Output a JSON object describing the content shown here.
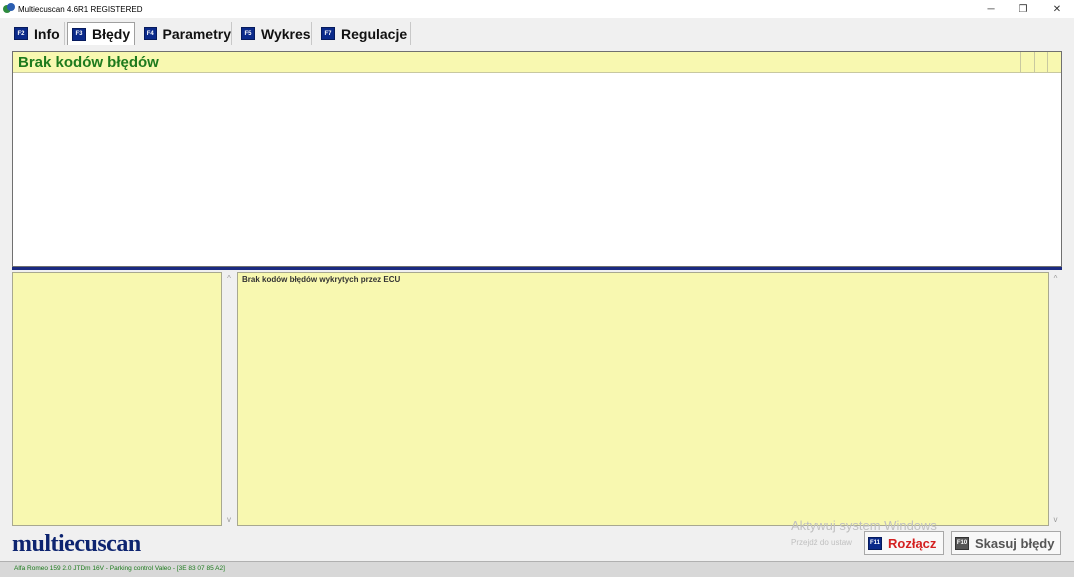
{
  "window": {
    "title": "Multiecuscan 4.6R1 REGISTERED",
    "min_glyph": "─",
    "max_glyph": "❐",
    "close_glyph": "✕"
  },
  "tabs": [
    {
      "key": "F2",
      "label": "Info",
      "active": false
    },
    {
      "key": "F3",
      "label": "Błędy",
      "active": true
    },
    {
      "key": "F4",
      "label": "Parametry",
      "active": false
    },
    {
      "key": "F5",
      "label": "Wykres",
      "active": false
    },
    {
      "key": "F7",
      "label": "Regulacje",
      "active": false
    }
  ],
  "upper_panel": {
    "title": "Brak kodów błędów"
  },
  "lower_panel": {
    "message": "Brak kodów błędów wykrytych przez ECU",
    "scroll_up": "^",
    "scroll_down": "v"
  },
  "footer": {
    "logo": "multiecuscan",
    "watermark_line1": "Aktywuj system Windows",
    "watermark_line2": "Przejdź do ustaw",
    "disconnect": {
      "key": "F11",
      "label": "Rozłącz"
    },
    "clear_errors": {
      "key": "F10",
      "label": "Skasuj błędy"
    }
  },
  "status": {
    "text": "Alfa Romeo 159 2.0 JTDm 16V - Parking control Valeo - [3E 83 07 85 A2]"
  },
  "colors": {
    "accent": "#0b2a8a",
    "panel_yellow": "#f8f8b0",
    "title_green": "#1d7a1d",
    "disconnect_red": "#d42020"
  }
}
